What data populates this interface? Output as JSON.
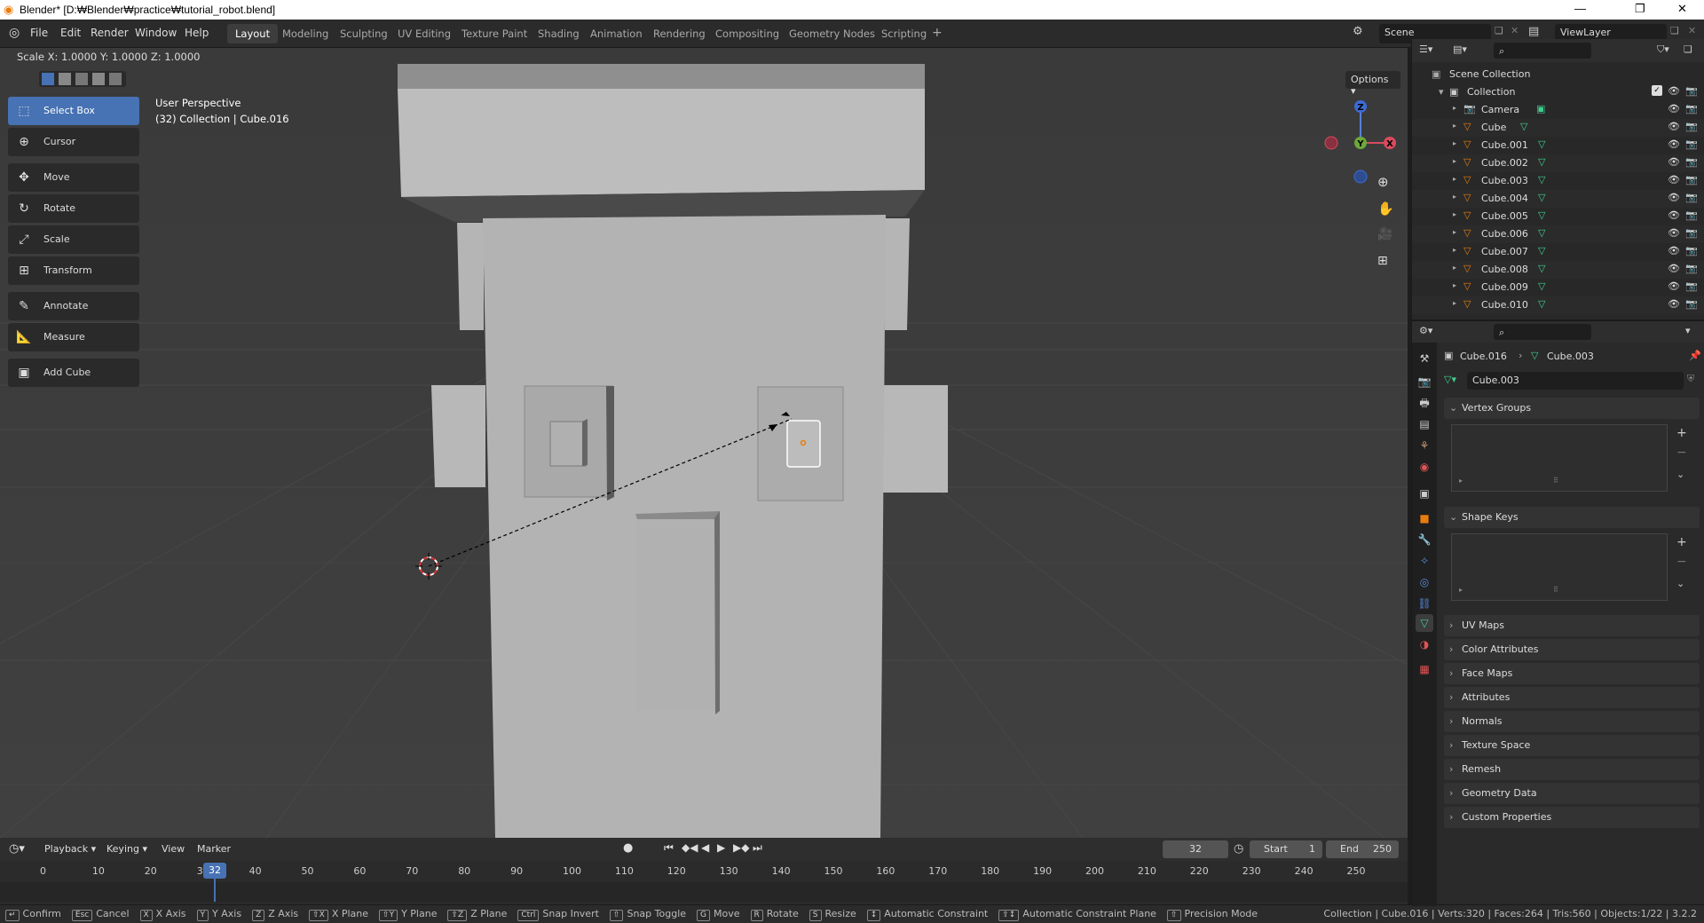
{
  "window": {
    "title": "Blender* [D:₩Blender₩practice₩tutorial_robot.blend]"
  },
  "menu": [
    "File",
    "Edit",
    "Render",
    "Window",
    "Help"
  ],
  "workspaces": [
    "Layout",
    "Modeling",
    "Sculpting",
    "UV Editing",
    "Texture Paint",
    "Shading",
    "Animation",
    "Rendering",
    "Compositing",
    "Geometry Nodes",
    "Scripting"
  ],
  "active_workspace": "Layout",
  "scene": {
    "name": "Scene",
    "view_layer": "ViewLayer"
  },
  "viewport": {
    "header_text": "Scale X: 1.0000   Y: 1.0000   Z: 1.0000",
    "perspective": "User Perspective",
    "collection_info": "(32) Collection | Cube.016",
    "options_label": "Options",
    "gizmo": {
      "x": "X",
      "y": "Y",
      "z": "Z"
    }
  },
  "tools": [
    {
      "label": "Select Box",
      "icon": "select-box-icon",
      "active": true
    },
    {
      "label": "Cursor",
      "icon": "cursor-icon"
    },
    {
      "label": "Move",
      "icon": "move-icon"
    },
    {
      "label": "Rotate",
      "icon": "rotate-icon"
    },
    {
      "label": "Scale",
      "icon": "scale-icon"
    },
    {
      "label": "Transform",
      "icon": "transform-icon"
    },
    {
      "label": "Annotate",
      "icon": "annotate-icon"
    },
    {
      "label": "Measure",
      "icon": "measure-icon"
    },
    {
      "label": "Add Cube",
      "icon": "add-cube-icon"
    }
  ],
  "timeline": {
    "menus": [
      "Playback",
      "Keying",
      "View",
      "Marker"
    ],
    "current_frame": "32",
    "start_label": "Start",
    "start": "1",
    "end_label": "End",
    "end": "250",
    "ticks": [
      "0",
      "10",
      "20",
      "30",
      "40",
      "50",
      "60",
      "70",
      "80",
      "90",
      "100",
      "110",
      "120",
      "130",
      "140",
      "150",
      "160",
      "170",
      "180",
      "190",
      "200",
      "210",
      "220",
      "230",
      "240",
      "250"
    ],
    "playhead": "32"
  },
  "outliner": {
    "scene_collection": "Scene Collection",
    "collection": "Collection",
    "items": [
      "Camera",
      "Cube",
      "Cube.001",
      "Cube.002",
      "Cube.003",
      "Cube.004",
      "Cube.005",
      "Cube.006",
      "Cube.007",
      "Cube.008",
      "Cube.009",
      "Cube.010"
    ]
  },
  "properties": {
    "breadcrumb_object": "Cube.016",
    "breadcrumb_data": "Cube.003",
    "mesh_name": "Cube.003",
    "panels_open": [
      "Vertex Groups",
      "Shape Keys"
    ],
    "panels_closed": [
      "UV Maps",
      "Color Attributes",
      "Face Maps",
      "Attributes",
      "Normals",
      "Texture Space",
      "Remesh",
      "Geometry Data",
      "Custom Properties"
    ]
  },
  "statusbar": {
    "hints": [
      {
        "key": "↵",
        "label": "Confirm"
      },
      {
        "key": "Esc",
        "label": "Cancel"
      },
      {
        "key": "X",
        "label": "X Axis"
      },
      {
        "key": "Y",
        "label": "Y Axis"
      },
      {
        "key": "Z",
        "label": "Z Axis"
      },
      {
        "key": "⇧X",
        "label": "X Plane"
      },
      {
        "key": "⇧Y",
        "label": "Y Plane"
      },
      {
        "key": "⇧Z",
        "label": "Z Plane"
      },
      {
        "key": "Ctrl",
        "label": "Snap Invert"
      },
      {
        "key": "⇧",
        "label": "Snap Toggle"
      },
      {
        "key": "G",
        "label": "Move"
      },
      {
        "key": "R",
        "label": "Rotate"
      },
      {
        "key": "S",
        "label": "Resize"
      },
      {
        "key": "↕",
        "label": "Automatic Constraint"
      },
      {
        "key": "⇧↕",
        "label": "Automatic Constraint Plane"
      },
      {
        "key": "⇧",
        "label": "Precision Mode"
      }
    ],
    "stats": "Collection | Cube.016 | Verts:320 | Faces:264 | Tris:560 | Objects:1/22 | 3.2.2"
  },
  "colors": {
    "accent": "#4772b3",
    "viewport_bg": "#3d3d3d",
    "mesh": "#b3b3b3",
    "selected_outline": "#ffffff"
  }
}
